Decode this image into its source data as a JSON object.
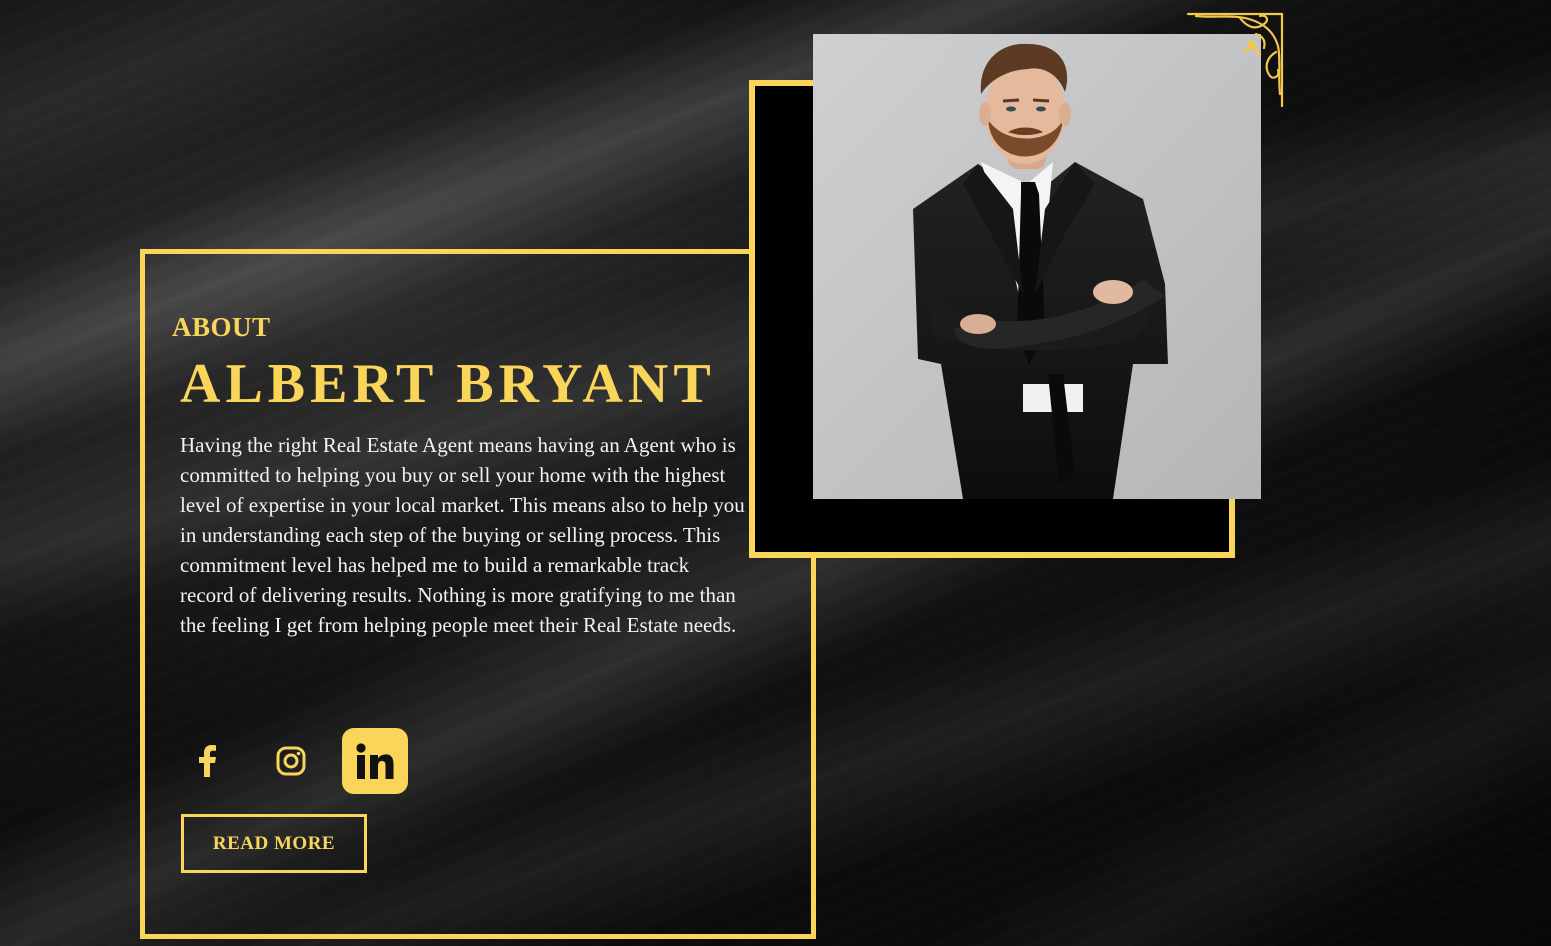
{
  "colors": {
    "accent": "#f9d55a",
    "background": "#0c0c0c",
    "text": "#f3f3f3",
    "photo_background": "#c4c5c6"
  },
  "about": {
    "label": "ABOUT",
    "name": "ALBERT BRYANT",
    "bio": "Having the right Real Estate Agent means having an Agent who is committed to helping you buy or sell your home with the highest level of expertise in your local market. This means also to help you in understanding each step of the buying or selling process. This commitment level has helped me to build a remarkable track record of delivering results. Nothing is more gratifying to me than the feeling I get from helping people meet their Real Estate needs."
  },
  "social": [
    {
      "icon": "facebook-icon",
      "active": false
    },
    {
      "icon": "instagram-icon",
      "active": false
    },
    {
      "icon": "linkedin-icon",
      "active": true
    }
  ],
  "cta": {
    "read_more_label": "READ MORE"
  },
  "photo": {
    "subject": "man-in-black-suit-arms-crossed"
  }
}
